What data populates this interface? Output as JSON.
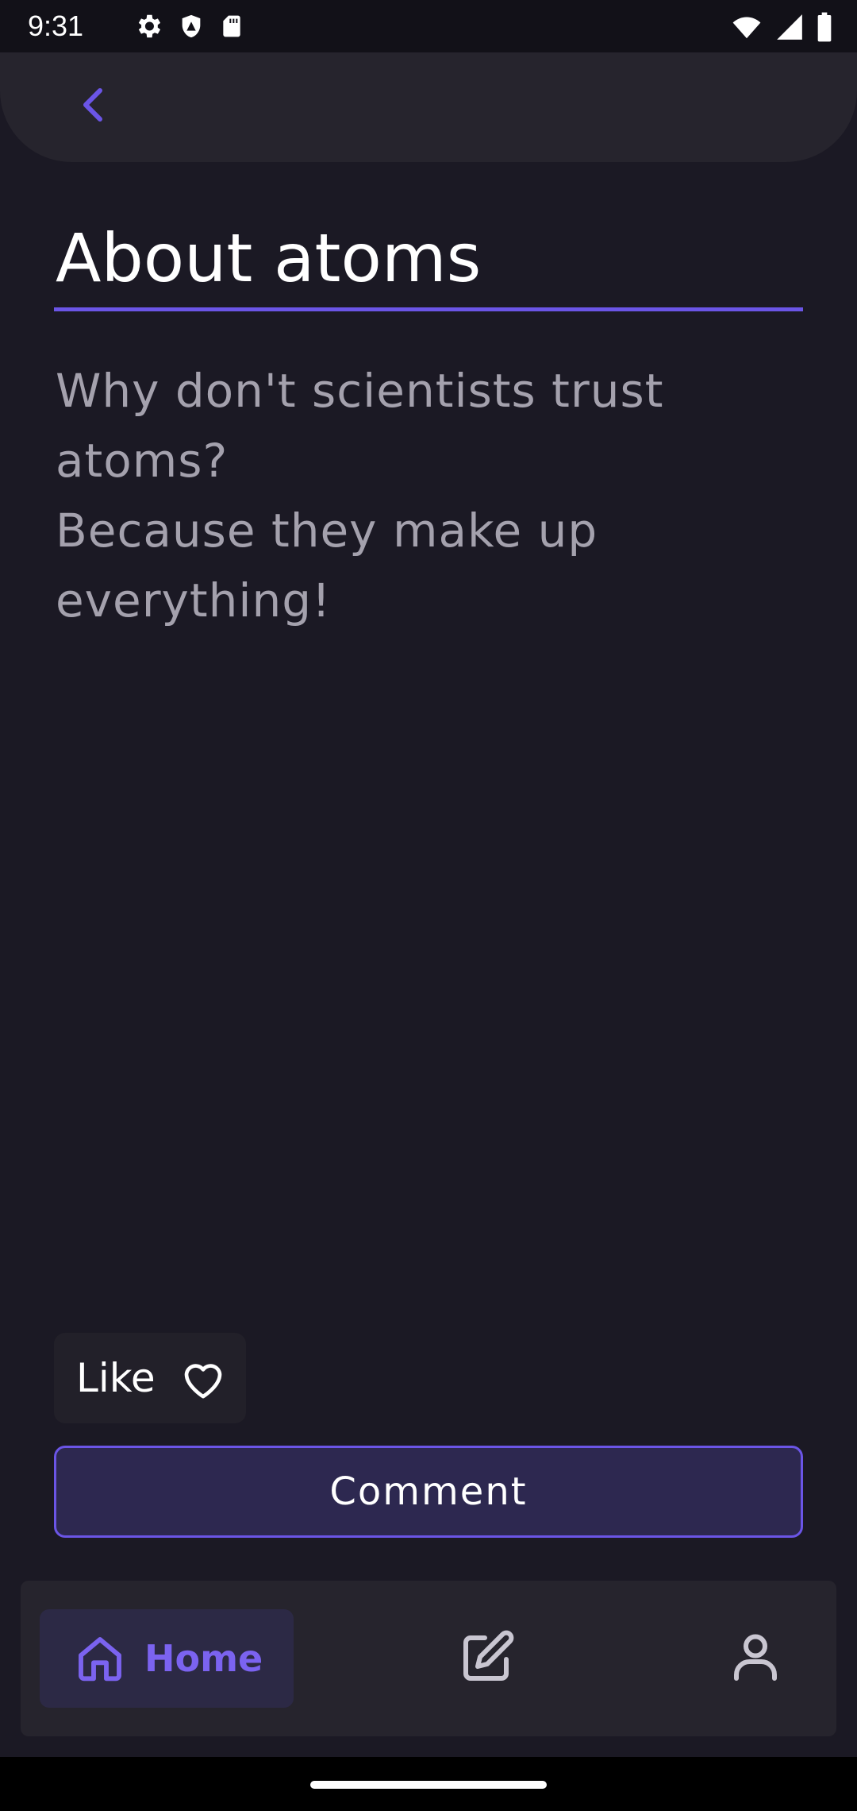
{
  "status_bar": {
    "time": "9:31",
    "left_icons": [
      "gear-icon",
      "shield-icon",
      "sd-card-icon"
    ],
    "right_icons": [
      "wifi-icon",
      "signal-icon",
      "battery-icon"
    ]
  },
  "top_bar": {
    "back_icon": "chevron-left-icon"
  },
  "post": {
    "title": "About atoms",
    "body": "Why don't scientists trust\natoms?\nBecause they make up\neverything!"
  },
  "actions": {
    "like_label": "Like",
    "like_icon": "heart-outline-icon",
    "comment_label": "Comment"
  },
  "bottom_nav": {
    "items": [
      {
        "label": "Home",
        "icon": "home-icon",
        "active": true
      },
      {
        "label": "",
        "icon": "edit-icon",
        "active": false
      },
      {
        "label": "",
        "icon": "user-icon",
        "active": false
      }
    ]
  },
  "colors": {
    "background": "#1b1924",
    "accent": "#6b55e6",
    "surface": "#26242d",
    "body_text": "#a4a1ad"
  }
}
